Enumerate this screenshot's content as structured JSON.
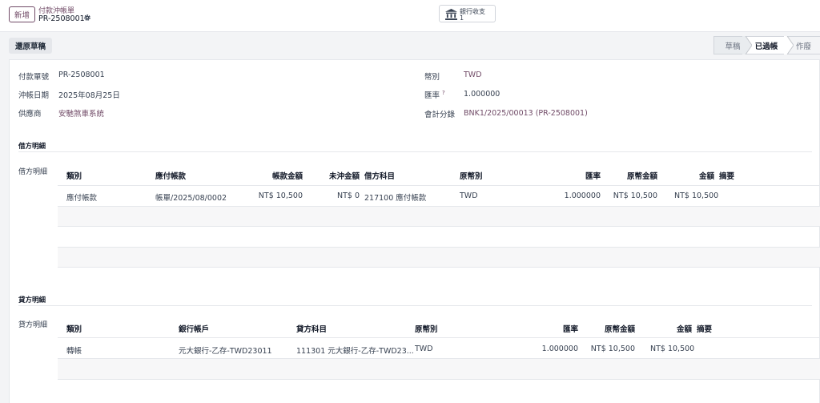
{
  "control": {
    "new_label": "新增",
    "breadcrumb_parent": "付款沖帳單",
    "breadcrumb_current": "PR-2508001",
    "smart_button": {
      "label": "銀行收支",
      "count": "1"
    }
  },
  "actions": {
    "reset_draft": "還原草稿"
  },
  "statusbar": {
    "draft": "草稿",
    "posted": "已過帳",
    "cancel": "作廢"
  },
  "form": {
    "payment_no": {
      "label": "付款單號",
      "value": "PR-2508001"
    },
    "date": {
      "label": "沖帳日期",
      "value": "2025年08月25日"
    },
    "vendor": {
      "label": "供應商",
      "value": "安馳煞車系統"
    },
    "currency": {
      "label": "幣別",
      "value": "TWD"
    },
    "rate": {
      "label": "匯率",
      "tooltip": "?",
      "value": "1.000000"
    },
    "journal": {
      "label": "會計分錄",
      "value": "BNK1/2025/00013 (PR-2508001)"
    }
  },
  "debit": {
    "section_title": "借方明細",
    "field_label": "借方明細",
    "headers": {
      "type": "類別",
      "payable": "應付帳款",
      "amount": "帳款金額",
      "unreconciled": "未沖金額",
      "account": "借方科目",
      "orig_currency": "原幣別",
      "rate": "匯率",
      "orig_amount": "原幣金額",
      "total": "金額",
      "memo": "摘要"
    },
    "rows": [
      {
        "type": "應付帳款",
        "payable": "帳單/2025/08/0002",
        "amount": "NT$ 10,500",
        "unreconciled": "NT$ 0",
        "account": "217100 應付帳款",
        "orig_currency": "TWD",
        "rate": "1.000000",
        "orig_amount": "NT$ 10,500",
        "total": "NT$ 10,500",
        "memo": ""
      }
    ]
  },
  "credit": {
    "section_title": "貸方明細",
    "field_label": "貸方明細",
    "headers": {
      "type": "類別",
      "bank": "銀行帳戶",
      "account": "貸方科目",
      "orig_currency": "原幣別",
      "rate": "匯率",
      "orig_amount": "原幣金額",
      "total": "金額",
      "memo": "摘要"
    },
    "rows": [
      {
        "type": "轉帳",
        "bank": "元大銀行-乙存-TWD23011",
        "account": "111301 元大銀行-乙存-TWD23...",
        "orig_currency": "TWD",
        "rate": "1.000000",
        "orig_amount": "NT$ 10,500",
        "total": "NT$ 10,500",
        "memo": ""
      }
    ]
  },
  "colors": {
    "brand": "#714b67",
    "border": "#e5e7eb",
    "stripe": "#f7f7f8"
  }
}
